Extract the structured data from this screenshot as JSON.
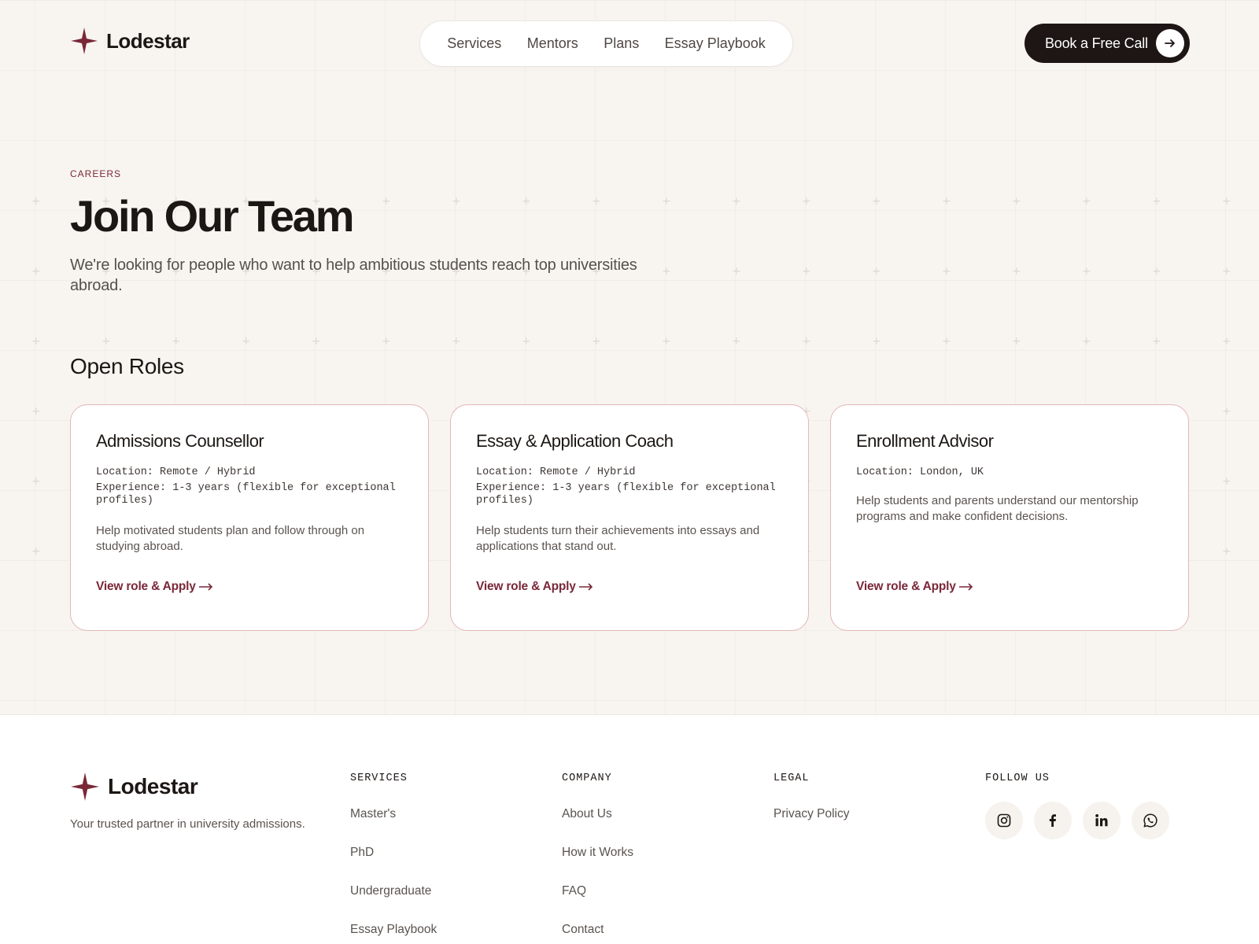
{
  "brand": {
    "name": "Lodestar",
    "accent": "#7a2838",
    "dark": "#1d1614"
  },
  "header": {
    "nav": [
      "Services",
      "Mentors",
      "Plans",
      "Essay Playbook"
    ],
    "cta_label": "Book a Free Call",
    "cta_icon": "arrow-right-icon"
  },
  "hero": {
    "eyebrow": "CAREERS",
    "title": "Join Our Team",
    "subtitle": "We're looking for people who want to help ambitious students reach top universities abroad."
  },
  "roles": {
    "heading": "Open Roles",
    "items": [
      {
        "title": "Admissions Counsellor",
        "location": "Location: Remote / Hybrid",
        "experience": "Experience: 1-3 years (flexible for exceptional profiles)",
        "description": "Help motivated students plan and follow through on studying abroad.",
        "link": "View role & Apply"
      },
      {
        "title": "Essay & Application Coach",
        "location": "Location: Remote / Hybrid",
        "experience": "Experience: 1-3 years (flexible for exceptional profiles)",
        "description": "Help students turn their achievements into essays and applications that stand out.",
        "link": "View role & Apply"
      },
      {
        "title": "Enrollment Advisor",
        "location": "Location: London, UK",
        "experience": "",
        "description": "Help students and parents understand our mentorship programs and make confident decisions.",
        "link": "View role & Apply"
      }
    ]
  },
  "footer": {
    "brand": "Lodestar",
    "tagline": "Your trusted partner in university admissions.",
    "services": {
      "heading": "SERVICES",
      "links": [
        "Master's",
        "PhD",
        "Undergraduate",
        "Essay Playbook"
      ]
    },
    "company": {
      "heading": "COMPANY",
      "links": [
        "About Us",
        "How it Works",
        "FAQ",
        "Contact"
      ]
    },
    "legal": {
      "heading": "LEGAL",
      "links": [
        "Privacy Policy"
      ]
    },
    "follow": {
      "heading": "FOLLOW US",
      "icons": [
        "instagram-icon",
        "facebook-icon",
        "linkedin-icon",
        "whatsapp-icon"
      ]
    }
  }
}
